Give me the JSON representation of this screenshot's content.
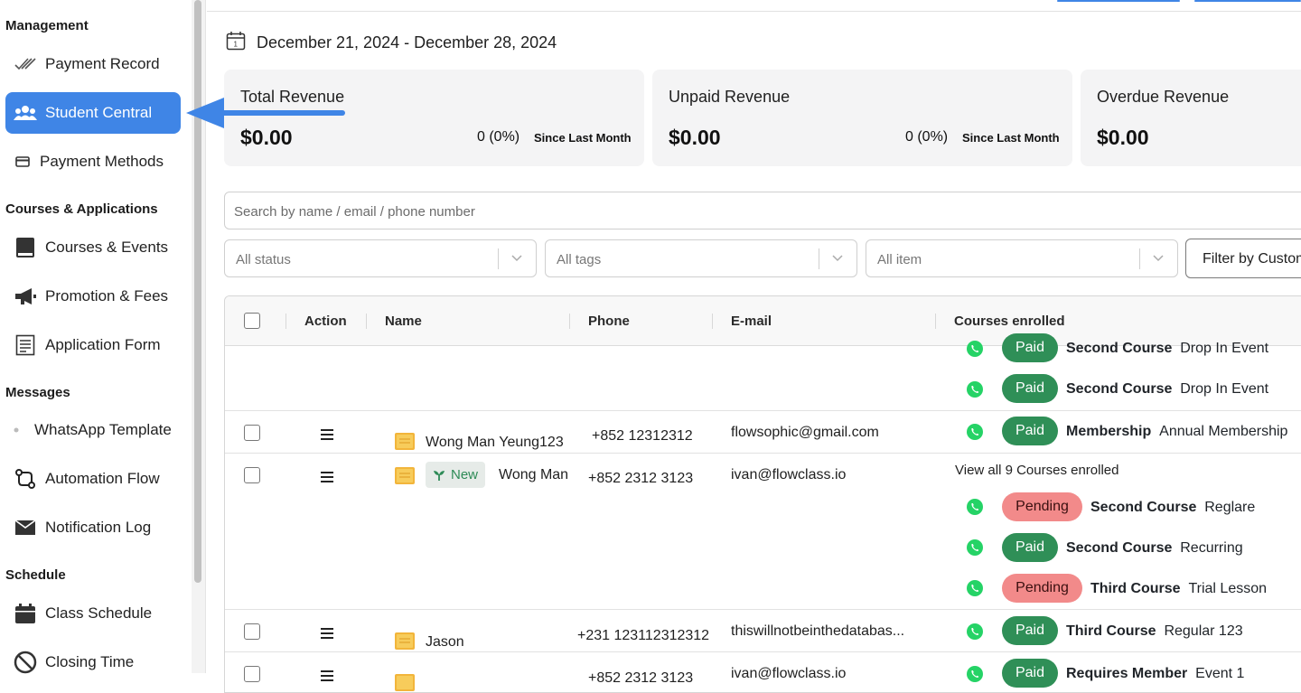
{
  "sidebar": {
    "sections": [
      {
        "title": "Management"
      },
      {
        "title": "Courses & Applications"
      },
      {
        "title": "Messages"
      },
      {
        "title": "Schedule"
      }
    ],
    "items": [
      {
        "label": "Payment Record",
        "icon": "double-check-icon"
      },
      {
        "label": "Student Central",
        "icon": "users-icon",
        "active": true
      },
      {
        "label": "Payment Methods",
        "icon": "card-icon"
      },
      {
        "label": "Courses & Events",
        "icon": "book-icon"
      },
      {
        "label": "Promotion & Fees",
        "icon": "megaphone-icon"
      },
      {
        "label": "Application Form",
        "icon": "form-icon"
      },
      {
        "label": "WhatsApp Template",
        "icon": "dot-icon"
      },
      {
        "label": "Automation Flow",
        "icon": "flow-icon"
      },
      {
        "label": "Notification Log",
        "icon": "mail-icon"
      },
      {
        "label": "Class Schedule",
        "icon": "calendar-icon"
      },
      {
        "label": "Closing Time",
        "icon": "prohibited-icon"
      }
    ]
  },
  "date_range": "December 21, 2024 - December 28, 2024",
  "cards": [
    {
      "title": "Total Revenue",
      "value": "$0.00",
      "change": "0 (0%)",
      "since": "Since Last Month"
    },
    {
      "title": "Unpaid Revenue",
      "value": "$0.00",
      "change": "0 (0%)",
      "since": "Since Last Month"
    },
    {
      "title": "Overdue Revenue",
      "value": "$0.00"
    }
  ],
  "search": {
    "placeholder": "Search by name / email / phone number"
  },
  "filters": {
    "status": "All status",
    "tags": "All tags",
    "item": "All item",
    "custom_button": "Filter by Custom"
  },
  "table": {
    "headers": {
      "action": "Action",
      "name": "Name",
      "phone": "Phone",
      "email": "E-mail",
      "courses": "Courses enrolled"
    },
    "top_courses": [
      {
        "status": "Paid",
        "course": "Second Course",
        "type": "Drop In Event"
      },
      {
        "status": "Paid",
        "course": "Second Course",
        "type": "Drop In Event"
      }
    ],
    "rows": [
      {
        "name": "Wong Man Yeung123",
        "phone": "+852 12312312",
        "email": "flowsophic@gmail.com",
        "courses": [
          {
            "status": "Paid",
            "course": "Membership",
            "type": "Annual Membership"
          }
        ]
      },
      {
        "new_tag": "New",
        "name": "Wong Man",
        "phone": "+852 2312 3123",
        "email": "ivan@flowclass.io",
        "view_all": "View all 9 Courses enrolled",
        "courses": [
          {
            "status": "Pending",
            "course": "Second Course",
            "type": "Reglare"
          },
          {
            "status": "Paid",
            "course": "Second Course",
            "type": "Recurring"
          },
          {
            "status": "Pending",
            "course": "Third Course",
            "type": "Trial Lesson"
          }
        ]
      },
      {
        "name": "Jason",
        "phone": "+231 123112312312",
        "email": "thiswillnotbeinthedatabas...",
        "courses": [
          {
            "status": "Paid",
            "course": "Third Course",
            "type": "Regular 123"
          }
        ]
      },
      {
        "phone": "+852 2312 3123",
        "email": "ivan@flowclass.io",
        "courses": [
          {
            "status": "Paid",
            "course": "Requires Member",
            "type": "Event 1"
          }
        ]
      }
    ]
  },
  "colors": {
    "accent": "#3f85e6",
    "paid": "#2f8f57",
    "pending": "#f28a8a",
    "whatsapp": "#25d366"
  }
}
